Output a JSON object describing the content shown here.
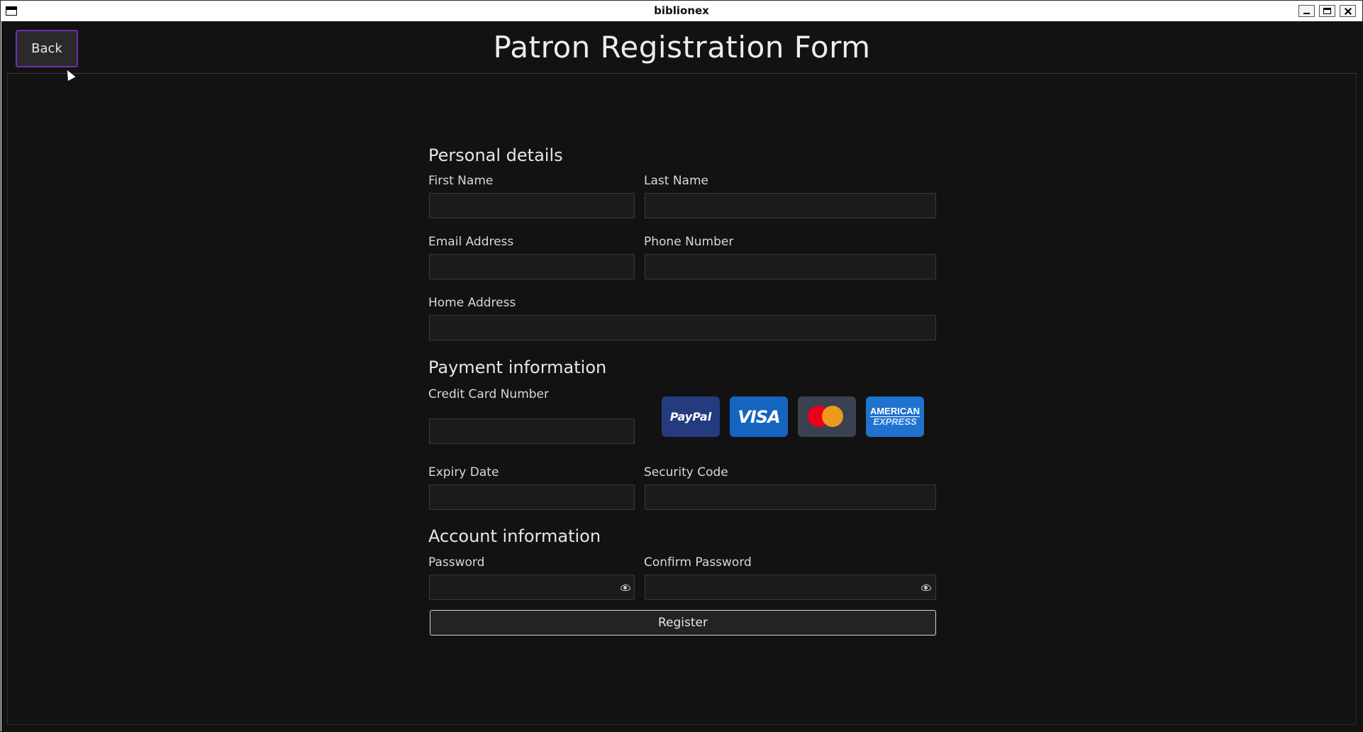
{
  "window": {
    "title": "biblionex"
  },
  "header": {
    "back_label": "Back",
    "page_title": "Patron Registration Form"
  },
  "form": {
    "personal": {
      "title": "Personal details",
      "first_name_label": "First Name",
      "first_name_value": "",
      "last_name_label": "Last Name",
      "last_name_value": "",
      "email_label": "Email Address",
      "email_value": "",
      "phone_label": "Phone Number",
      "phone_value": "",
      "address_label": "Home Address",
      "address_value": ""
    },
    "payment": {
      "title": "Payment information",
      "card_number_label": "Credit Card Number",
      "card_number_value": "",
      "expiry_label": "Expiry Date",
      "expiry_value": "",
      "security_label": "Security Code",
      "security_value": "",
      "cards": {
        "paypal": "PayPal",
        "visa": "VISA",
        "amex_line1": "AMERICAN",
        "amex_line2": "EXPRESS"
      }
    },
    "account": {
      "title": "Account information",
      "password_label": "Password",
      "password_value": "",
      "confirm_label": "Confirm Password",
      "confirm_value": ""
    },
    "register_label": "Register"
  },
  "colors": {
    "background": "#121212",
    "accent_border": "#6b2fb6",
    "field_bg": "#1b1b1b",
    "text": "#e0e0e0"
  }
}
